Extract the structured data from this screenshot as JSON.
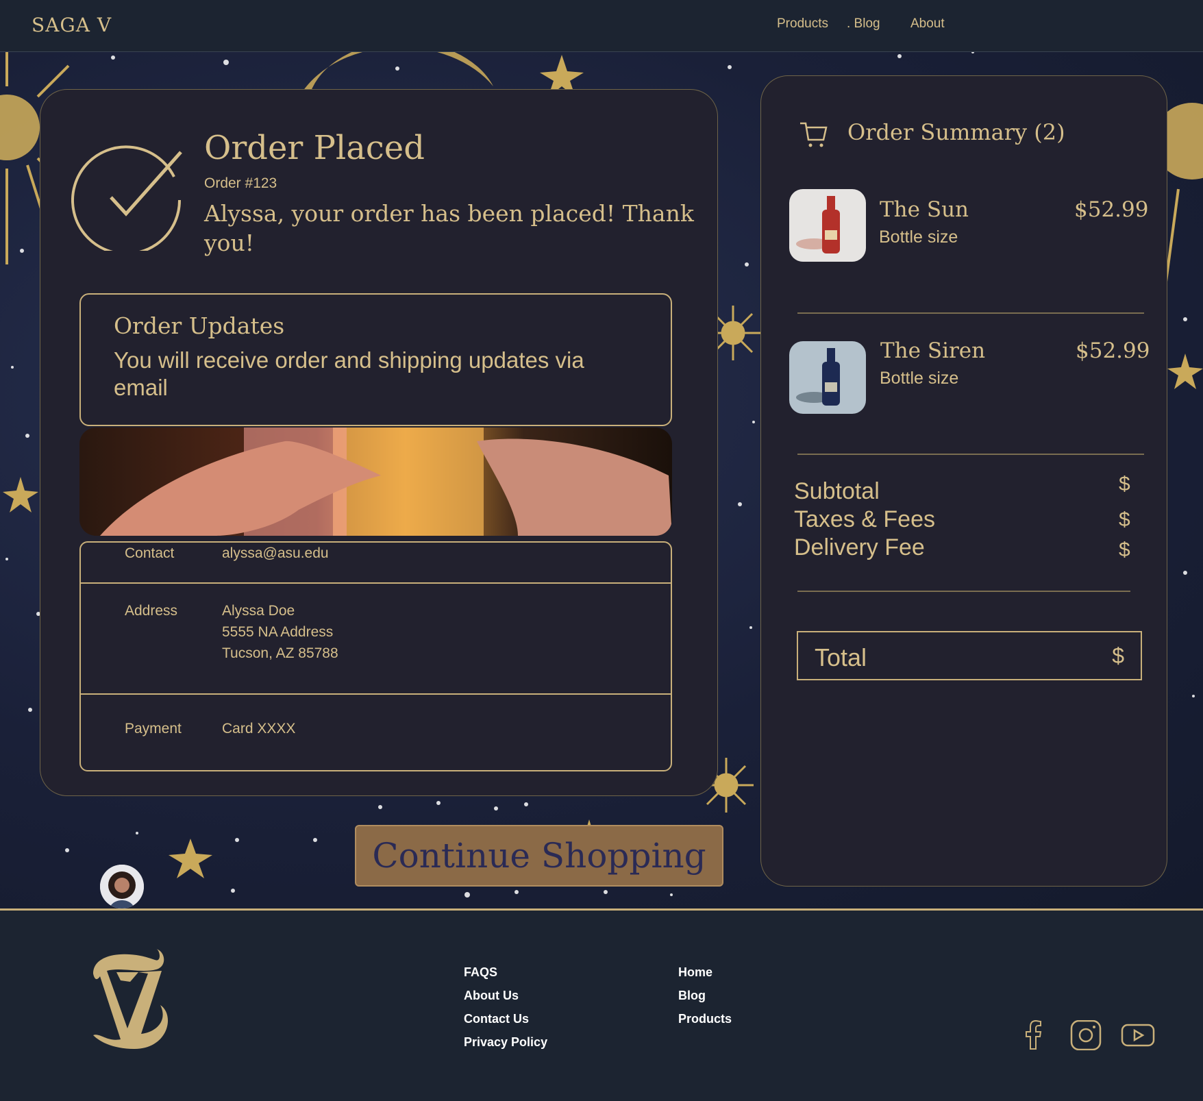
{
  "nav": {
    "brand": "SAGA V",
    "links": [
      "Products",
      ". Blog",
      "About"
    ]
  },
  "order": {
    "title": "Order Placed",
    "number": "Order #123",
    "message": "Alyssa, your order has been placed! Thank you!"
  },
  "updates": {
    "title": "Order Updates",
    "text": "You will receive order and shipping updates via email"
  },
  "details": {
    "contact_label": "Contact",
    "contact_value": "alyssa@asu.edu",
    "address_label": "Address",
    "address_lines": [
      "Alyssa Doe",
      "5555 NA Address",
      "Tucson, AZ 85788"
    ],
    "payment_label": "Payment",
    "payment_value": "Card XXXX"
  },
  "continue_label": "Continue Shopping",
  "summary": {
    "title": "Order Summary (2)",
    "items": [
      {
        "name": "The Sun",
        "size": "Bottle size",
        "price": "$52.99",
        "bottle_color": "#b3312a"
      },
      {
        "name": "The Siren",
        "size": "Bottle size",
        "price": "$52.99",
        "bottle_color": "#1d2a52"
      }
    ],
    "fees": [
      {
        "label": "Subtotal",
        "value": "$"
      },
      {
        "label": "Taxes & Fees",
        "value": "$"
      },
      {
        "label": "Delivery Fee",
        "value": "$"
      }
    ],
    "total_label": "Total",
    "total_value": "$"
  },
  "footer": {
    "col1": [
      "FAQS",
      "About Us",
      "Contact Us",
      "Privacy Policy"
    ],
    "col2": [
      "Home",
      "Blog",
      "Products"
    ],
    "social": [
      "facebook-icon",
      "instagram-icon",
      "youtube-icon"
    ]
  },
  "colors": {
    "gold": "#d6bf8b",
    "panel": "#22212e",
    "navy": "#1c2431",
    "button": "#8b6a47"
  }
}
